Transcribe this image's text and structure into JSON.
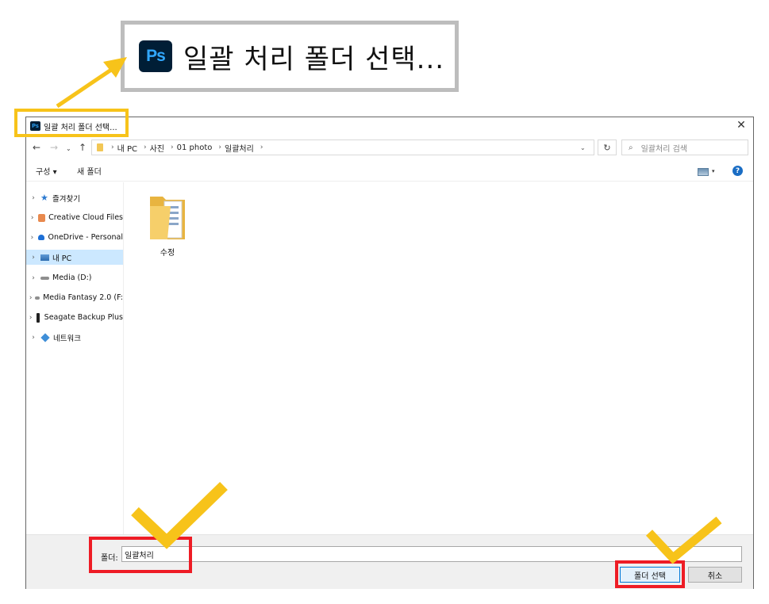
{
  "callout": {
    "ps_label": "Ps",
    "title": "일괄 처리 폴더 선택..."
  },
  "dialog": {
    "title_icon_label": "Ps",
    "title": "일괄 처리 폴더 선택...",
    "close_label": "✕",
    "nav": {
      "back": "←",
      "forward": "→",
      "recent": "⌄",
      "up": "↑",
      "address": [
        "내 PC",
        "사진",
        "01 photo",
        "일괄처리"
      ],
      "sep": "›",
      "address_dropdown": "⌄",
      "refresh": "↻",
      "search_placeholder": "일괄처리 검색",
      "search_icon": "⌕"
    },
    "toolbar": {
      "organize": "구성 ▾",
      "new_folder": "새 폴더",
      "view_dropdown": "▾",
      "help": "?"
    },
    "tree": [
      {
        "label": "즐겨찾기",
        "icon": "star"
      },
      {
        "label": "Creative Cloud Files",
        "icon": "creative-cloud"
      },
      {
        "label": "OneDrive - Personal",
        "icon": "onedrive-cloud"
      },
      {
        "label": "내 PC",
        "icon": "pc",
        "selected": true
      },
      {
        "label": "Media (D:)",
        "icon": "drive"
      },
      {
        "label": "Media Fantasy 2.0 (F:",
        "icon": "drive"
      },
      {
        "label": "Seagate Backup Plus",
        "icon": "usb-drive"
      },
      {
        "label": "네트워크",
        "icon": "network"
      }
    ],
    "tree_arrow": "›",
    "star_glyph": "★",
    "folder_item": {
      "label": "수정"
    },
    "bottom": {
      "folder_label": "폴더:",
      "folder_value": "일괄처리",
      "select_button": "폴더 선택",
      "cancel_button": "취소"
    }
  },
  "colors": {
    "highlight_yellow": "#f7c31a",
    "highlight_red": "#ee1c25",
    "accent": "#0078d7"
  }
}
